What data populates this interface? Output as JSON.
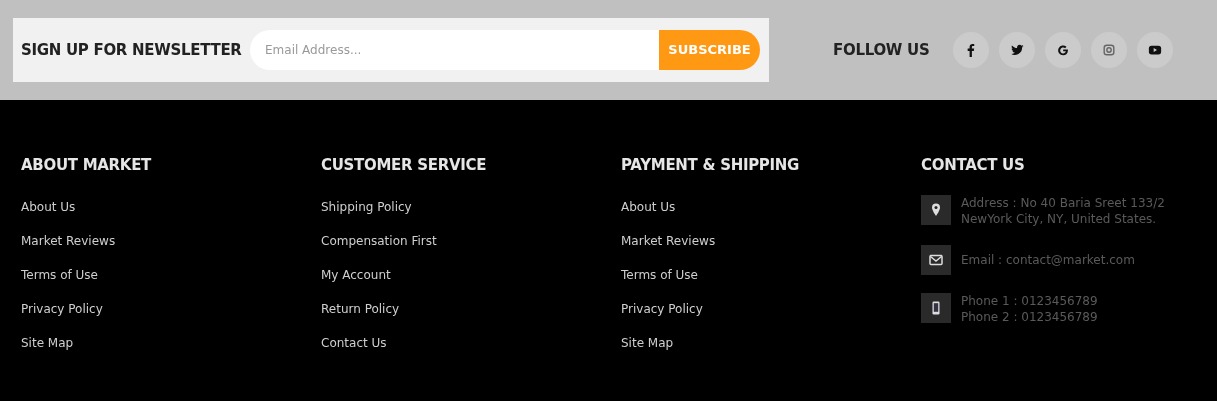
{
  "newsletter": {
    "title": "SIGN UP FOR NEWSLETTER",
    "email_field": {
      "placeholder": "Email Address..."
    },
    "button": "SUBSCRIBE"
  },
  "follow": {
    "title": "FOLLOW US",
    "links": [
      {
        "kind": "facebook"
      },
      {
        "kind": "twitter"
      },
      {
        "kind": "google"
      },
      {
        "kind": "instagram"
      },
      {
        "kind": "youtube"
      }
    ]
  },
  "columns": [
    {
      "title": "ABOUT MARKET",
      "links": [
        "About Us",
        "Market Reviews",
        "Terms of Use",
        "Privacy Policy",
        "Site Map"
      ]
    },
    {
      "title": "CUSTOMER SERVICE",
      "links": [
        "Shipping Policy",
        "Compensation First",
        "My Account",
        "Return Policy",
        "Contact Us"
      ]
    },
    {
      "title": "PAYMENT & SHIPPING",
      "links": [
        "About Us",
        "Market Reviews",
        "Terms of Use",
        "Privacy Policy",
        "Site Map"
      ]
    }
  ],
  "contact": {
    "title": "CONTACT US",
    "items": [
      {
        "kind": "address",
        "lines": [
          "Address : No 40 Baria Sreet 133/2",
          "NewYork City, NY, United States."
        ]
      },
      {
        "kind": "email",
        "lines": [
          "Email : contact@market.com"
        ]
      },
      {
        "kind": "phone",
        "lines": [
          "Phone 1 : 0123456789",
          "Phone 2 : 0123456789"
        ]
      }
    ]
  }
}
